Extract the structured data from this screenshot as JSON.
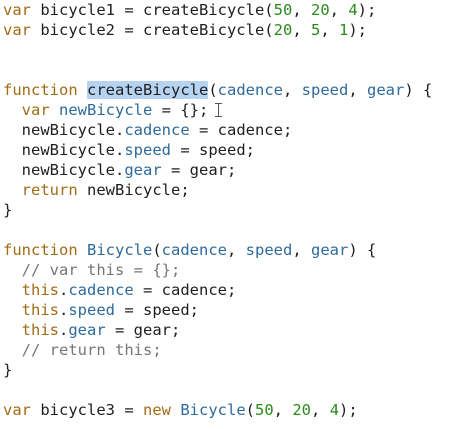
{
  "editor": {
    "lines": [
      [
        [
          "kw",
          "var"
        ],
        [
          "t",
          " bicycle1 = createBicycle("
        ],
        [
          "num",
          "50"
        ],
        [
          "t",
          ", "
        ],
        [
          "num",
          "20"
        ],
        [
          "t",
          ", "
        ],
        [
          "num",
          "4"
        ],
        [
          "t",
          ");"
        ]
      ],
      [
        [
          "kw",
          "var"
        ],
        [
          "t",
          " bicycle2 = createBicycle("
        ],
        [
          "num",
          "20"
        ],
        [
          "t",
          ", "
        ],
        [
          "num",
          "5"
        ],
        [
          "t",
          ", "
        ],
        [
          "num",
          "1"
        ],
        [
          "t",
          ");"
        ]
      ],
      [],
      [],
      [
        [
          "kw",
          "function"
        ],
        [
          "t",
          " "
        ],
        [
          "sel",
          "createBicycle"
        ],
        [
          "t",
          "("
        ],
        [
          "prop",
          "cadence"
        ],
        [
          "t",
          ", "
        ],
        [
          "prop",
          "speed"
        ],
        [
          "t",
          ", "
        ],
        [
          "prop",
          "gear"
        ],
        [
          "t",
          ") {"
        ]
      ],
      [
        [
          "t",
          "  "
        ],
        [
          "kw",
          "var"
        ],
        [
          "t",
          " "
        ],
        [
          "prop",
          "newBicycle"
        ],
        [
          "t",
          " = {};"
        ],
        [
          "cursor",
          ""
        ]
      ],
      [
        [
          "t",
          "  newBicycle."
        ],
        [
          "prop",
          "cadence"
        ],
        [
          "t",
          " = cadence;"
        ]
      ],
      [
        [
          "t",
          "  newBicycle."
        ],
        [
          "prop",
          "speed"
        ],
        [
          "t",
          " = speed;"
        ]
      ],
      [
        [
          "t",
          "  newBicycle."
        ],
        [
          "prop",
          "gear"
        ],
        [
          "t",
          " = gear;"
        ]
      ],
      [
        [
          "t",
          "  "
        ],
        [
          "kw",
          "return"
        ],
        [
          "t",
          " newBicycle;"
        ]
      ],
      [
        [
          "t",
          "}"
        ]
      ],
      [],
      [
        [
          "kw",
          "function"
        ],
        [
          "t",
          " "
        ],
        [
          "prop",
          "Bicycle"
        ],
        [
          "t",
          "("
        ],
        [
          "prop",
          "cadence"
        ],
        [
          "t",
          ", "
        ],
        [
          "prop",
          "speed"
        ],
        [
          "t",
          ", "
        ],
        [
          "prop",
          "gear"
        ],
        [
          "t",
          ") {"
        ]
      ],
      [
        [
          "t",
          "  "
        ],
        [
          "cmt",
          "// var this = {};"
        ]
      ],
      [
        [
          "t",
          "  "
        ],
        [
          "kw",
          "this"
        ],
        [
          "t",
          "."
        ],
        [
          "prop",
          "cadence"
        ],
        [
          "t",
          " = cadence;"
        ]
      ],
      [
        [
          "t",
          "  "
        ],
        [
          "kw",
          "this"
        ],
        [
          "t",
          "."
        ],
        [
          "prop",
          "speed"
        ],
        [
          "t",
          " = speed;"
        ]
      ],
      [
        [
          "t",
          "  "
        ],
        [
          "kw",
          "this"
        ],
        [
          "t",
          "."
        ],
        [
          "prop",
          "gear"
        ],
        [
          "t",
          " = gear;"
        ]
      ],
      [
        [
          "t",
          "  "
        ],
        [
          "cmt",
          "// return this;"
        ]
      ],
      [
        [
          "t",
          "}"
        ]
      ],
      [],
      [
        [
          "kw",
          "var"
        ],
        [
          "t",
          " bicycle3 = "
        ],
        [
          "kw",
          "new"
        ],
        [
          "t",
          " "
        ],
        [
          "prop",
          "Bicycle"
        ],
        [
          "t",
          "("
        ],
        [
          "num",
          "50"
        ],
        [
          "t",
          ", "
        ],
        [
          "num",
          "20"
        ],
        [
          "t",
          ", "
        ],
        [
          "num",
          "4"
        ],
        [
          "t",
          ");"
        ]
      ]
    ]
  }
}
